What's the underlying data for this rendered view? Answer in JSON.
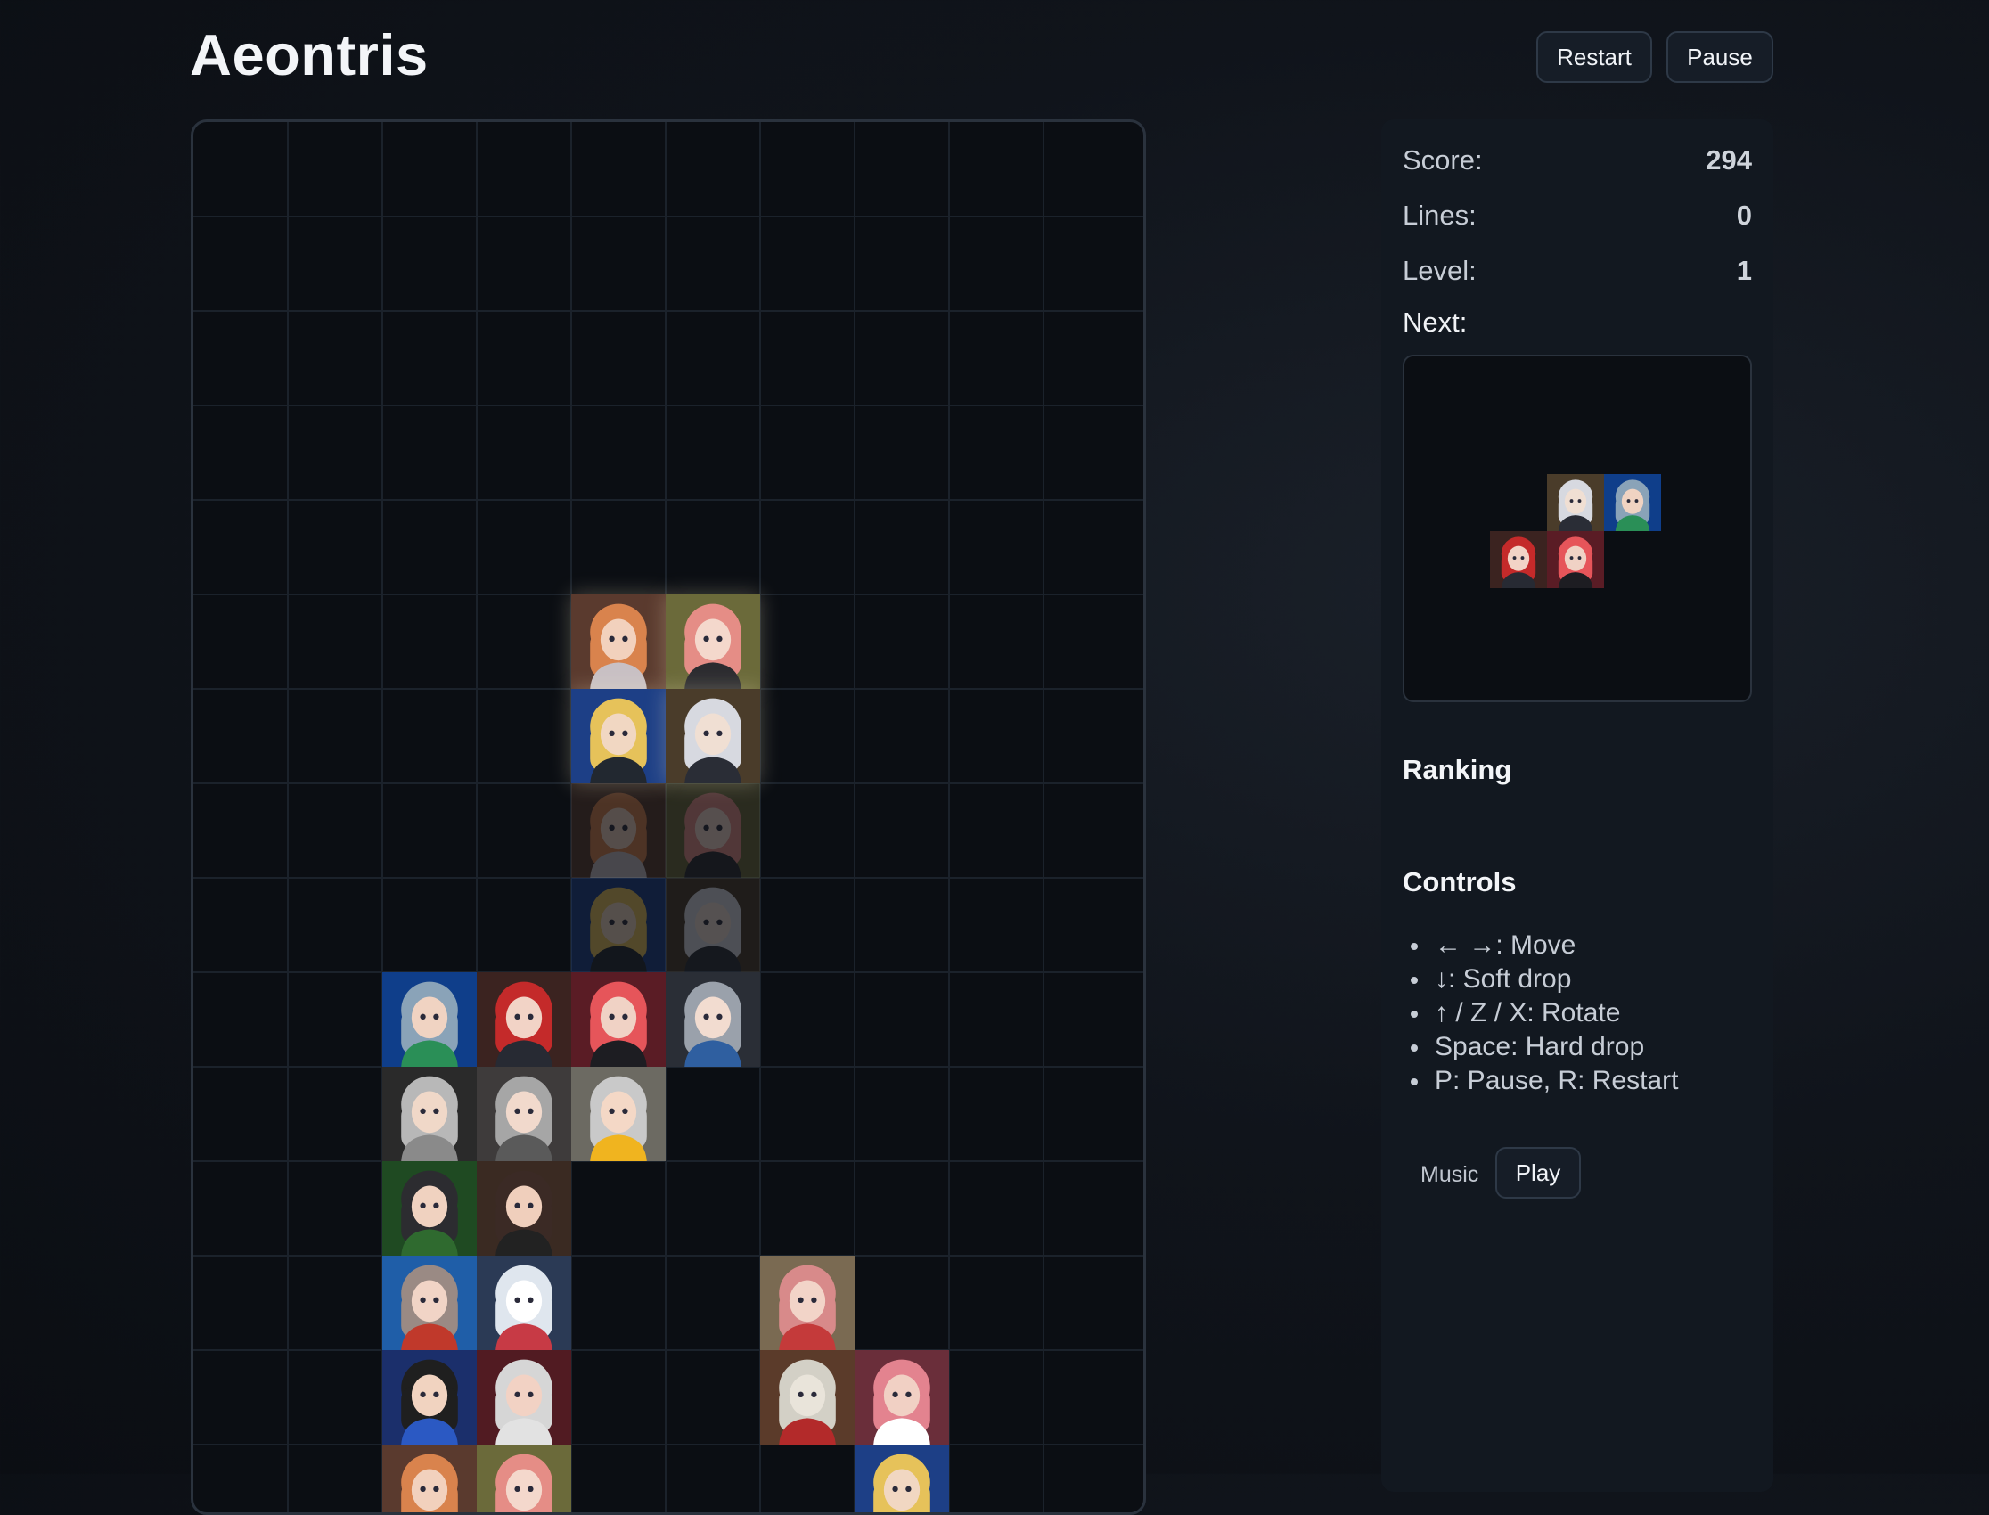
{
  "app": {
    "title": "Aeontris"
  },
  "header": {
    "restart_label": "Restart",
    "pause_label": "Pause"
  },
  "stats": {
    "score_label": "Score:",
    "score": "294",
    "lines_label": "Lines:",
    "lines": "0",
    "level_label": "Level:",
    "level": "1",
    "next_label": "Next:"
  },
  "board": {
    "columns": 10,
    "piece_images": "anime character portraits",
    "active_piece": {
      "shape": "O",
      "cells": [
        [
          4,
          5
        ],
        [
          5,
          5
        ],
        [
          4,
          6
        ],
        [
          5,
          6
        ]
      ]
    },
    "ghost_piece": {
      "shape": "O",
      "cells": [
        [
          4,
          7
        ],
        [
          5,
          7
        ],
        [
          4,
          8
        ],
        [
          5,
          8
        ]
      ]
    },
    "locked_cells": [
      {
        "col": 2,
        "row": 9
      },
      {
        "col": 3,
        "row": 9
      },
      {
        "col": 4,
        "row": 9
      },
      {
        "col": 5,
        "row": 9
      },
      {
        "col": 2,
        "row": 10
      },
      {
        "col": 3,
        "row": 10
      },
      {
        "col": 4,
        "row": 10
      },
      {
        "col": 2,
        "row": 11
      },
      {
        "col": 3,
        "row": 11
      },
      {
        "col": 2,
        "row": 12
      },
      {
        "col": 3,
        "row": 12
      },
      {
        "col": 6,
        "row": 12
      },
      {
        "col": 2,
        "row": 13
      },
      {
        "col": 3,
        "row": 13
      },
      {
        "col": 6,
        "row": 13
      },
      {
        "col": 7,
        "row": 13
      },
      {
        "col": 2,
        "row": 14
      },
      {
        "col": 3,
        "row": 14
      },
      {
        "col": 7,
        "row": 14
      }
    ]
  },
  "next_piece": {
    "shape": "S",
    "cells": [
      [
        1,
        0
      ],
      [
        2,
        0
      ],
      [
        0,
        1
      ],
      [
        1,
        1
      ]
    ]
  },
  "ranking": {
    "heading": "Ranking"
  },
  "controls": {
    "heading": "Controls",
    "items": [
      "← →: Move",
      "↓: Soft drop",
      "↑ / Z / X: Rotate",
      "Space: Hard drop",
      "P: Pause, R: Restart"
    ]
  },
  "music": {
    "label": "Music",
    "button_label": "Play"
  },
  "colors": {
    "background": "#0b0e13",
    "panel": "#121820",
    "board_border": "#2a323d",
    "grid": "#1b222b",
    "button_bg": "#161d27",
    "text": "#e6e9ee"
  }
}
